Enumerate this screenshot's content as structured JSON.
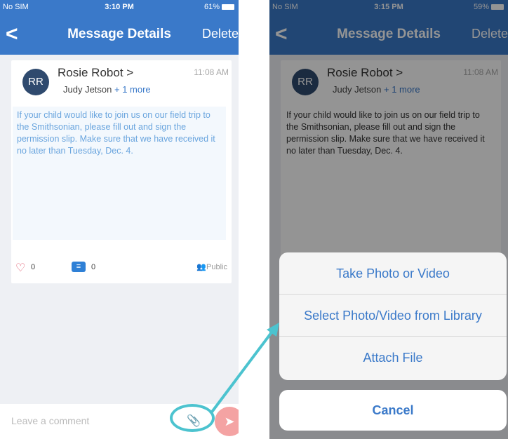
{
  "left_screen": {
    "status": {
      "carrier": "No SIM",
      "time": "3:10 PM",
      "battery": "61%"
    },
    "nav": {
      "back": "<",
      "title": "Message Details",
      "delete": "Delete"
    },
    "message": {
      "avatar_initials": "RR",
      "sender": "Rosie Robot >",
      "recipient": "Judy Jetson",
      "recipient_more": "+ 1 more",
      "time": "11:08 AM",
      "body": "If your child would like to join us on our field trip to the Smithsonian, please fill out and sign the permission slip. Make sure that we have received it no later than Tuesday, Dec. 4.",
      "likes": "0",
      "comments": "0",
      "visibility": "Public"
    },
    "comment": {
      "placeholder": "Leave a comment"
    }
  },
  "right_screen": {
    "status": {
      "carrier": "No SIM",
      "time": "3:15 PM",
      "battery": "59%"
    },
    "nav": {
      "back": "<",
      "title": "Message Details",
      "delete": "Delete"
    },
    "message": {
      "avatar_initials": "RR",
      "sender": "Rosie Robot >",
      "recipient": "Judy Jetson",
      "recipient_more": "+ 1 more",
      "time": "11:08 AM",
      "body": "If your child would like to join us on our field trip to the Smithsonian, please fill out and sign the permission slip. Make sure that we have received it no later than Tuesday, Dec. 4."
    },
    "action_sheet": {
      "options": [
        "Take Photo or Video",
        "Select Photo/Video from Library",
        "Attach File"
      ],
      "cancel": "Cancel"
    }
  },
  "colors": {
    "primary": "#3a79c9",
    "highlight": "#4cc3cf",
    "send": "#f4a3a3",
    "heart": "#e0566b"
  }
}
